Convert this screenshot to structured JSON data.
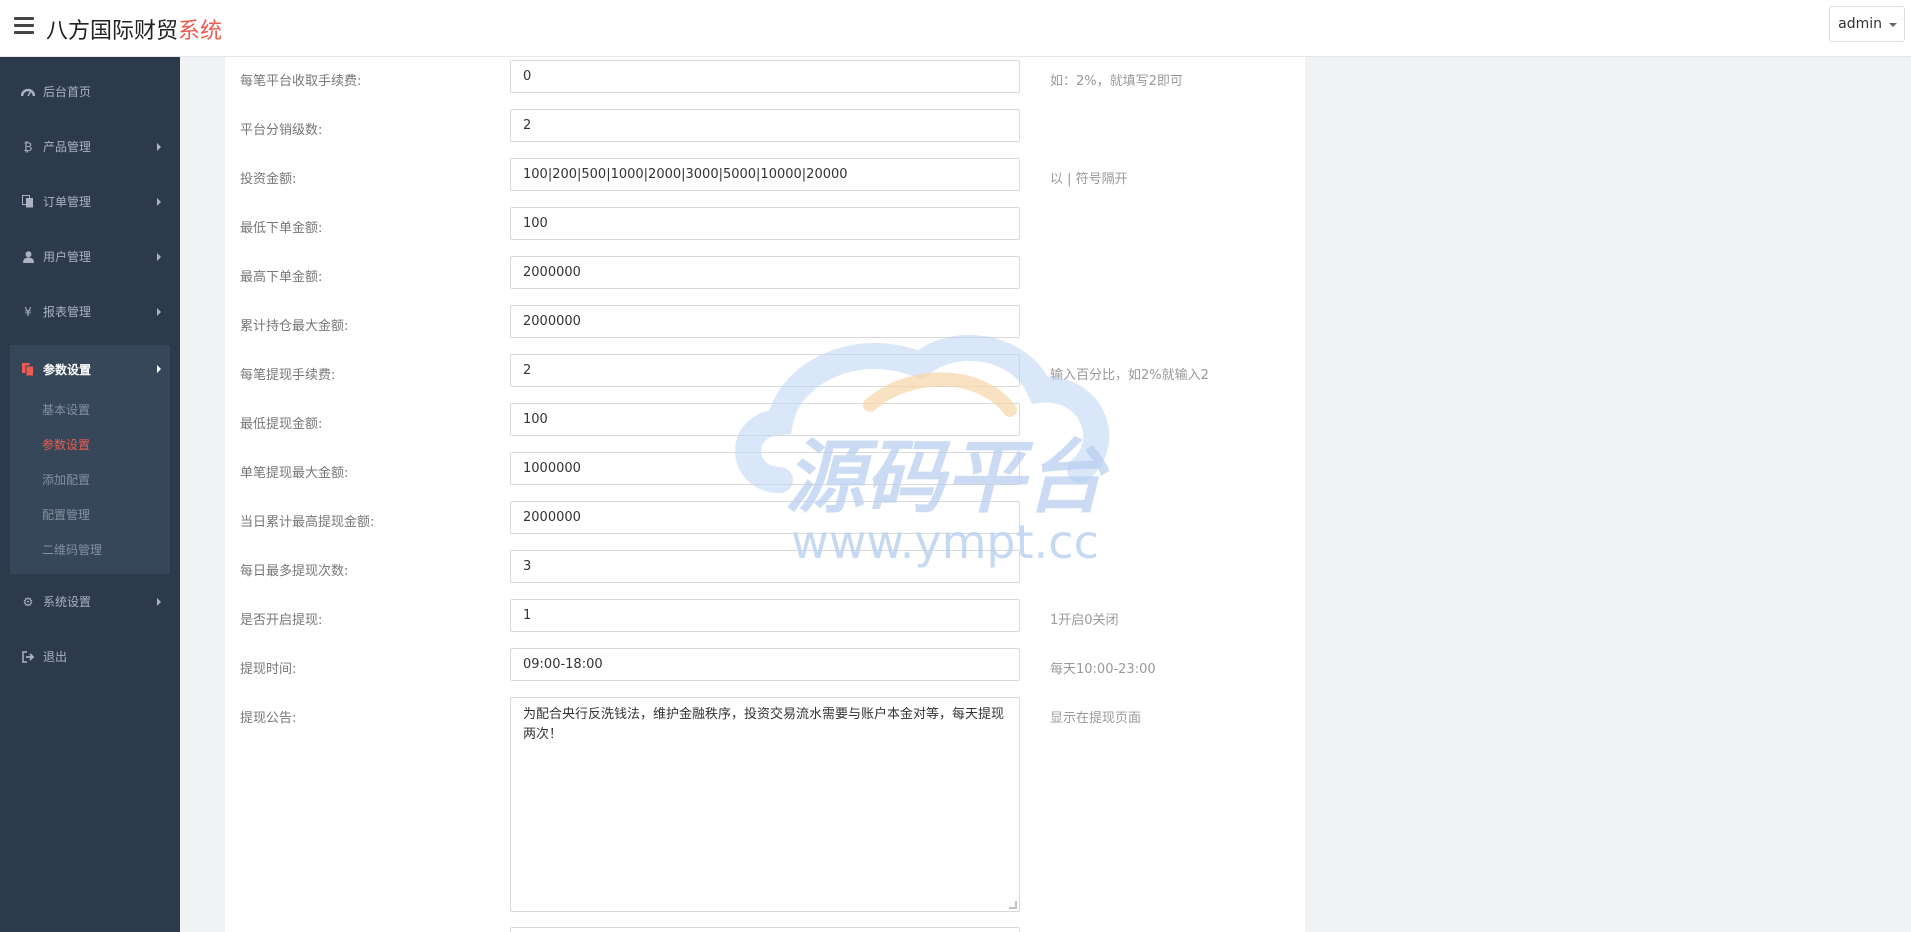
{
  "header": {
    "brand_main": "八方国际财贸",
    "brand_accent": "系统",
    "user": "admin"
  },
  "sidebar": {
    "items": [
      {
        "label": "后台首页",
        "icon": "dashboard-icon"
      },
      {
        "label": "产品管理",
        "icon": "bitcoin-icon"
      },
      {
        "label": "订单管理",
        "icon": "copy-icon"
      },
      {
        "label": "用户管理",
        "icon": "user-icon"
      },
      {
        "label": "报表管理",
        "icon": "yen-icon"
      }
    ],
    "active_group": {
      "label": "参数设置",
      "icon": "files-icon",
      "subitems": [
        "基本设置",
        "参数设置",
        "添加配置",
        "配置管理",
        "二维码管理"
      ]
    },
    "bottom_items": [
      {
        "label": "系统设置",
        "icon": "cogs-icon"
      },
      {
        "label": "退出",
        "icon": "sign-out-icon"
      }
    ]
  },
  "form": {
    "rows": [
      {
        "label": "每笔平台收取手续费:",
        "value": "0",
        "hint": "如：2%，就填写2即可"
      },
      {
        "label": "平台分销级数:",
        "value": "2",
        "hint": ""
      },
      {
        "label": "投资金额:",
        "value": "100|200|500|1000|2000|3000|5000|10000|20000",
        "hint": "以 | 符号隔开"
      },
      {
        "label": "最低下单金额:",
        "value": "100",
        "hint": ""
      },
      {
        "label": "最高下单金额:",
        "value": "2000000",
        "hint": ""
      },
      {
        "label": "累计持仓最大金额:",
        "value": "2000000",
        "hint": ""
      },
      {
        "label": "每笔提现手续费:",
        "value": "2",
        "hint": "输入百分比，如2%就输入2"
      },
      {
        "label": "最低提现金额:",
        "value": "100",
        "hint": ""
      },
      {
        "label": "单笔提现最大金额:",
        "value": "1000000",
        "hint": ""
      },
      {
        "label": "当日累计最高提现金额:",
        "value": "2000000",
        "hint": ""
      },
      {
        "label": "每日最多提现次数:",
        "value": "3",
        "hint": ""
      },
      {
        "label": "是否开启提现:",
        "value": "1",
        "hint": "1开启0关闭"
      },
      {
        "label": "提现时间:",
        "value": "09:00-18:00",
        "hint": "每天10:00-23:00"
      }
    ],
    "notice": {
      "label": "提现公告:",
      "value": "为配合央行反洗钱法，维护金融秩序，投资交易流水需要与账户本金对等，每天提现两次！",
      "hint": "显示在提现页面"
    }
  },
  "watermark": {
    "title": "源码平台",
    "url": "www.ympt.cc"
  },
  "colors": {
    "accent": "#f05b4f",
    "sidebar_bg": "#2c3a4b"
  }
}
